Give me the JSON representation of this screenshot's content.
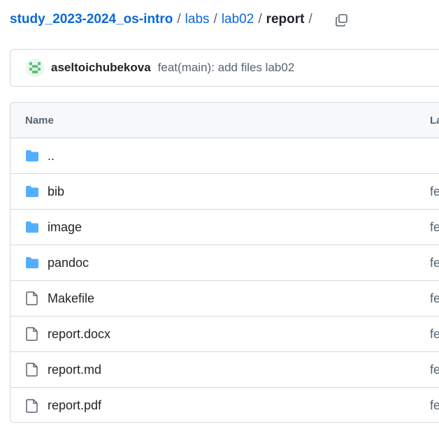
{
  "breadcrumb": {
    "repo": "study_2023-2024_os-intro",
    "sep": "/",
    "parts": [
      "labs",
      "lab02"
    ],
    "current": "report"
  },
  "commit": {
    "author": "aseltoichubekova",
    "message": "feat(main): add files lab02"
  },
  "table": {
    "col_name": "Name",
    "col_last": "La",
    "rows": [
      {
        "name": "..",
        "type": "folder",
        "msg": ""
      },
      {
        "name": "bib",
        "type": "folder",
        "msg": "fe"
      },
      {
        "name": "image",
        "type": "folder",
        "msg": "fe"
      },
      {
        "name": "pandoc",
        "type": "folder",
        "msg": "fe"
      },
      {
        "name": "Makefile",
        "type": "file",
        "msg": "fe"
      },
      {
        "name": "report.docx",
        "type": "file",
        "msg": "fe"
      },
      {
        "name": "report.md",
        "type": "file",
        "msg": "fe"
      },
      {
        "name": "report.pdf",
        "type": "file",
        "msg": "fe"
      }
    ]
  },
  "colors": {
    "link": "#0969da",
    "folder": "#54aeff",
    "file_icon": "#59636e"
  },
  "icons": {
    "copy": "copy-icon",
    "folder": "folder-icon",
    "file": "file-icon",
    "avatar": "avatar"
  }
}
